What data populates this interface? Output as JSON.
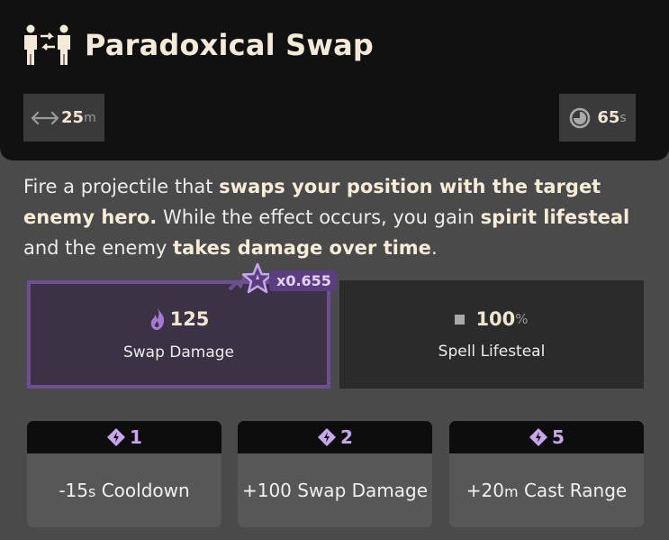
{
  "ability": {
    "title": "Paradoxical Swap",
    "icon": "swap-people-icon"
  },
  "stats": {
    "range_value": "25",
    "range_unit": "m",
    "cooldown_value": "65",
    "cooldown_unit": "s"
  },
  "description": {
    "p1": "Fire a projectile that ",
    "b1": "swaps your position with the target enemy hero.",
    "p2": " While the effect occurs, you gain ",
    "b2": "spirit lifesteal",
    "p3": " and the enemy ",
    "b3": "takes damage over time",
    "p4": "."
  },
  "properties": [
    {
      "value": "125",
      "unit": "",
      "label": "Swap Damage",
      "icon": "spirit-flame-icon",
      "scaling": "x0.655"
    },
    {
      "value": "100",
      "unit": "%",
      "label": "Spell Lifesteal",
      "icon": "square-icon"
    }
  ],
  "upgrades": [
    {
      "tier": "1",
      "text_pre": "-15",
      "text_unit": "s",
      "text_post": " Cooldown"
    },
    {
      "tier": "2",
      "text_pre": "+100 Swap Damage",
      "text_unit": "",
      "text_post": ""
    },
    {
      "tier": "5",
      "text_pre": "+20",
      "text_unit": "m",
      "text_post": " Cast Range"
    }
  ],
  "colors": {
    "header_bg": "#111111",
    "panel_bg": "#4a4a4a",
    "spirit_purple": "#6d4f92",
    "title_text": "#f3ead8"
  }
}
